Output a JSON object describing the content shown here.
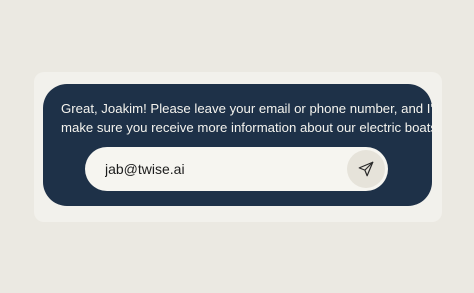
{
  "card": {
    "message_line1": "Great, Joakim! Please leave your email or phone number, and I'll",
    "message_line2": "make sure you receive more information about our electric boats."
  },
  "form": {
    "input_value": "jab@twise.ai",
    "send_icon": "send-icon"
  },
  "colors": {
    "background": "#ebe9e2",
    "card": "#1e3148",
    "input": "#f6f5f0",
    "send_button": "#e6e3da",
    "text_light": "#f4f3ee"
  }
}
